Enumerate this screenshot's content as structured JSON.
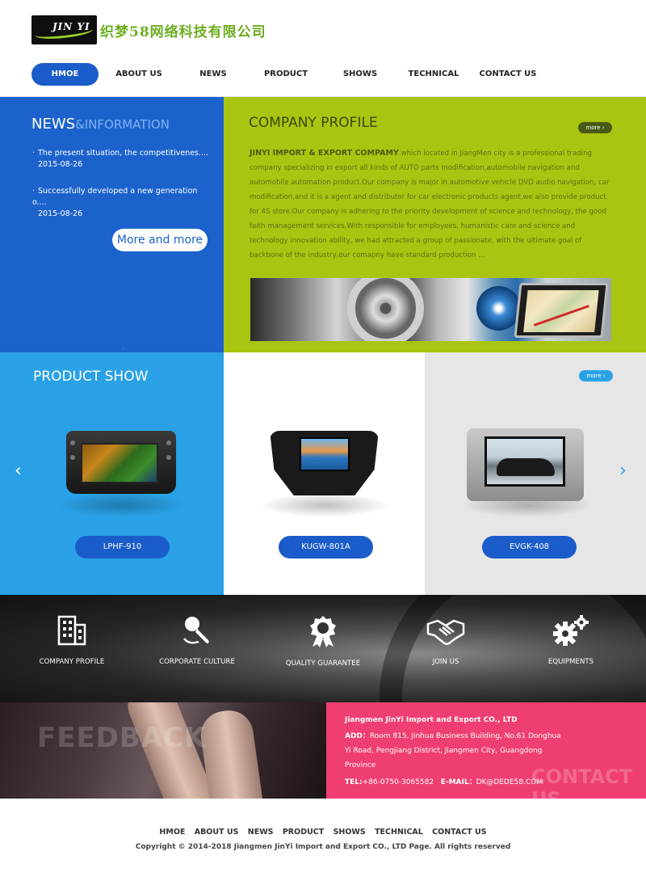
{
  "header": {
    "logo_text": "JIN YI",
    "company_cn": "织梦58网络科技有限公司"
  },
  "nav": {
    "items": [
      "HMOE",
      "ABOUT US",
      "NEWS",
      "PRODUCT",
      "SHOWS",
      "TECHNICAL",
      "CONTACT US"
    ],
    "active": "HMOE"
  },
  "news": {
    "title": "NEWS",
    "subtitle": "&INFORMATION",
    "items": [
      {
        "text": "The present situation, the competitivenes....",
        "date": "2015-08-26"
      },
      {
        "text": "Successfully developed a new generation o....",
        "date": "2015-08-26"
      }
    ],
    "more": "More and more"
  },
  "company_profile": {
    "title": "COMPANY PROFILE",
    "more": "more",
    "lead": "JINYI IMPORT & EXPORT COMPAMY",
    "text": " which located in JiangMen city is a professional trading company specializing in export all kinds of AUTO parts modification,automobile navigation and automobile automation product.Our company is major in automotive vehicle DVD audio navigation, car modification,and it is a agent and distributor for car electronic products agent,we also provide product for 4S store.Our company is adhering to the priority development of science and technology, the good faith management services.With responsible for employees, humanistic care and science and technology innovation ability, we had attracted a group of passionate, with the ultimate goal of backbone of the industry,our comapny have standard production ..."
  },
  "products": {
    "title": "PRODUCT SHOW",
    "more": "more",
    "prev": "‹",
    "next": "›",
    "items": [
      {
        "label": "LPHF-910"
      },
      {
        "label": "KUGW-801A"
      },
      {
        "label": "EVGK-408"
      }
    ]
  },
  "features": [
    {
      "label": "COMPANY PROFILE",
      "icon": "building-icon"
    },
    {
      "label": "CORPORATE CULTURE",
      "icon": "microphone-icon"
    },
    {
      "label": "QUALITY GUARANTEE",
      "icon": "award-ribbon-icon"
    },
    {
      "label": "JOIN US",
      "icon": "handshake-icon"
    },
    {
      "label": "EQUIPMENTS",
      "icon": "gears-icon"
    }
  ],
  "feedback": {
    "word": "FEEDBACK"
  },
  "contact": {
    "word": "CONTACT US",
    "company": "Jiangmen JinYi Import and Export CO., LTD",
    "addr_label": "ADD：",
    "addr": "Room 815, Jinhua Business Building, No.61 Donghua Yi Road, Pengjiang District, Jiangmen City, Guangdong Province",
    "tel_label": "TEL:",
    "tel": "+86-0750-3065582",
    "email_label": "E-MAIL：",
    "email": "DK@DEDE58.COM"
  },
  "footer": {
    "links": [
      "HMOE",
      "ABOUT US",
      "NEWS",
      "PRODUCT",
      "SHOWS",
      "TECHNICAL",
      "CONTACT US"
    ],
    "copyright": "Copyright © 2014-2018 Jiangmen JinYi Import and Export CO., LTD   Page. All rights reserved"
  },
  "colors": {
    "nav_active": "#1a5cc9",
    "news_bg": "#1c62cc",
    "company_bg": "#a9c511",
    "product_bg": "#2aa1e6",
    "contact_bg": "#ef3f72"
  }
}
